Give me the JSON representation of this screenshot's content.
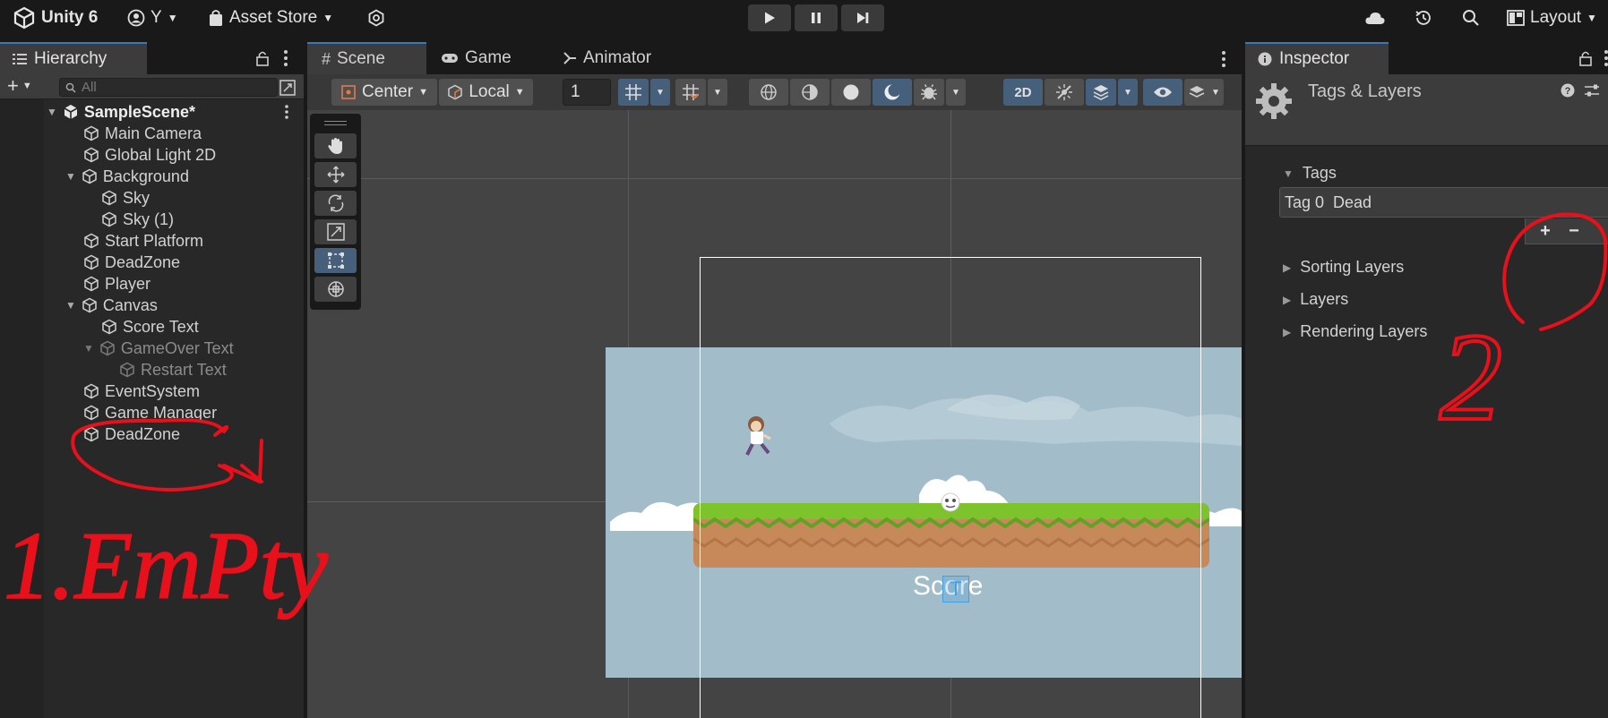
{
  "topbar": {
    "app_title": "Unity 6",
    "account": "Y",
    "asset_store": "Asset Store",
    "layout": "Layout"
  },
  "hierarchy": {
    "tab": "Hierarchy",
    "search_placeholder": "All",
    "scene_name": "SampleScene*",
    "items": [
      {
        "label": "Main Camera"
      },
      {
        "label": "Global Light 2D"
      },
      {
        "label": "Background"
      },
      {
        "label": "Sky"
      },
      {
        "label": "Sky (1)"
      },
      {
        "label": "Start Platform"
      },
      {
        "label": "DeadZone"
      },
      {
        "label": "Player"
      },
      {
        "label": "Canvas"
      },
      {
        "label": "Score Text"
      },
      {
        "label": "GameOver Text"
      },
      {
        "label": "Restart Text"
      },
      {
        "label": "EventSystem"
      },
      {
        "label": "Game Manager"
      },
      {
        "label": "DeadZone"
      }
    ]
  },
  "scene": {
    "tabs": [
      "Scene",
      "Game",
      "Animator"
    ],
    "pivot": "Center",
    "space": "Local",
    "grid_value": "1",
    "mode_2d": "2D",
    "score_text": "Score"
  },
  "inspector": {
    "tab": "Inspector",
    "title": "Tags & Layers",
    "tags_header": "Tags",
    "tag_row": "Tag 0  Dead",
    "plus": "+",
    "minus": "−",
    "sorting_layers": "Sorting Layers",
    "layers": "Layers",
    "rendering_layers": "Rendering Layers"
  },
  "annotations": {
    "color": "#e8101a",
    "note_1": "1.EmPty",
    "note_2": "2"
  }
}
